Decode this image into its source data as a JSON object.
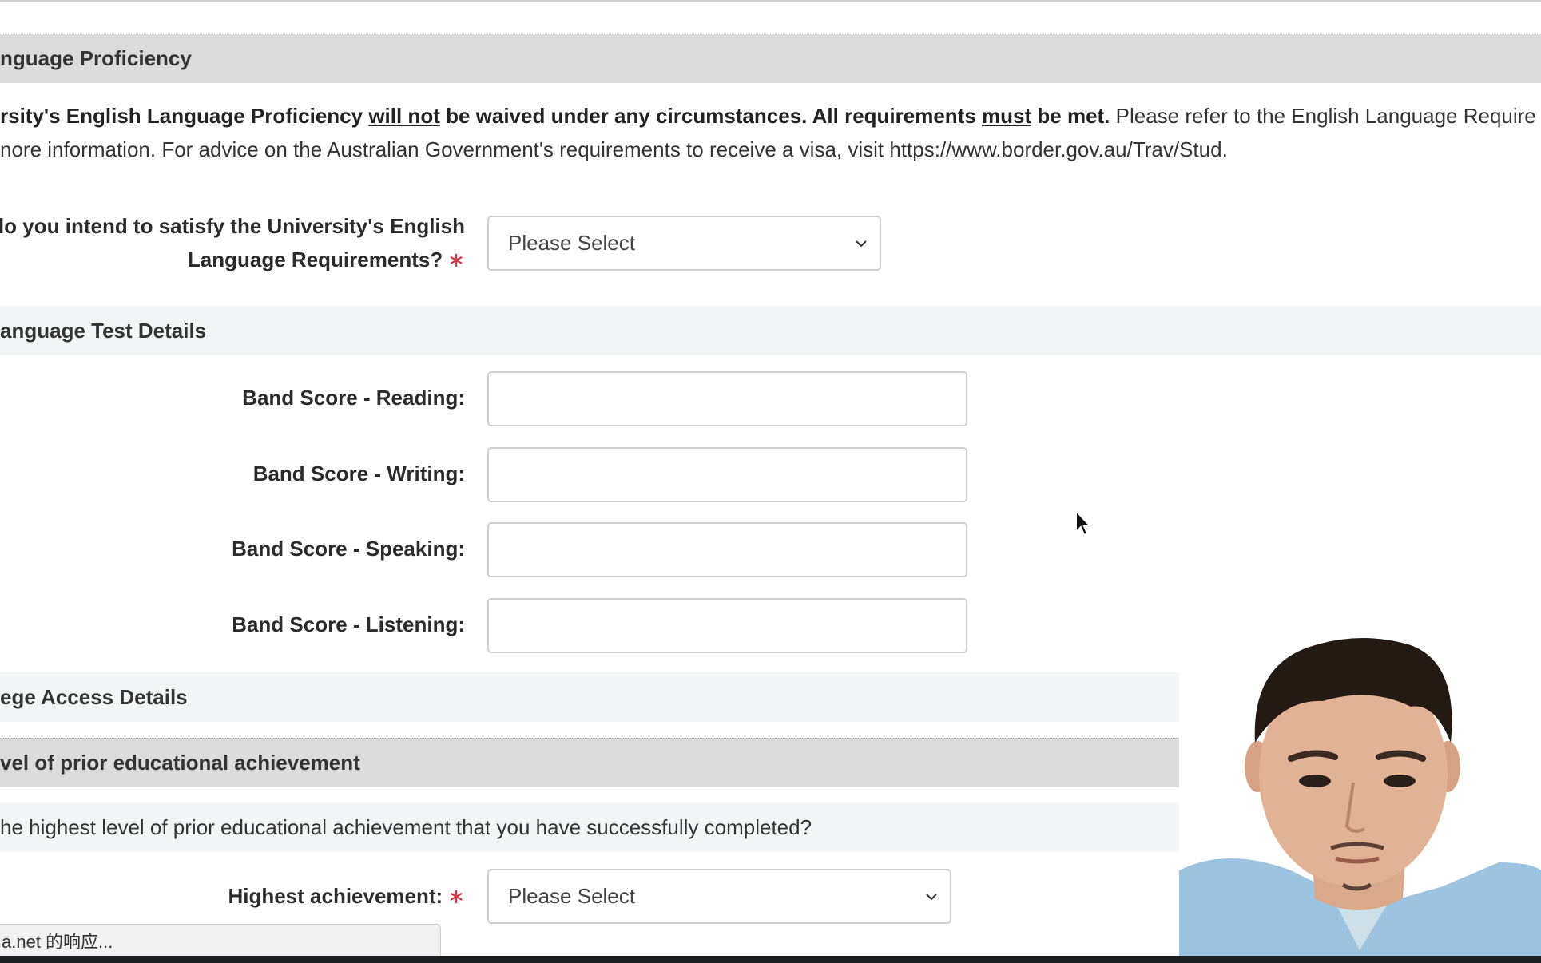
{
  "sections": {
    "english_proficiency": "nguage Proficiency",
    "language_test": "anguage Test Details",
    "college_access": "ege Access Details",
    "prior_education": "vel of prior educational achievement"
  },
  "notice": {
    "line1_bold1": "rsity's English Language Proficiency ",
    "line1_underline1": "will not",
    "line1_bold2": " be waived under any circumstances. All requirements ",
    "line1_underline2": "must",
    "line1_bold3": " be met.",
    "line1_rest": " Please refer to the English Language Require",
    "line2": "nore information. For advice on the Australian Government's requirements to receive a visa, visit https://www.border.gov.au/Trav/Stud."
  },
  "english_requirement": {
    "label_line1": "do you intend to satisfy the University's English",
    "label_line2": "Language Requirements?",
    "required_mark": "∗",
    "select_value": "Please Select"
  },
  "band_scores": {
    "reading_label": "Band Score - Reading:",
    "writing_label": "Band Score - Writing:",
    "speaking_label": "Band Score - Speaking:",
    "listening_label": "Band Score - Listening:",
    "reading_value": "",
    "writing_value": "",
    "speaking_value": "",
    "listening_value": ""
  },
  "prior_education": {
    "question": "he highest level of prior educational achievement that you have successfully completed?",
    "label": "Highest achievement:",
    "required_mark": "∗",
    "select_value": "Please Select"
  },
  "status_bar": {
    "text": "a.net 的响应..."
  },
  "colors": {
    "required": "#d1323b",
    "section_header_bg": "#dcdcdc",
    "subsection_bg": "#f4f5f6",
    "input_border": "#cfcfcf"
  }
}
